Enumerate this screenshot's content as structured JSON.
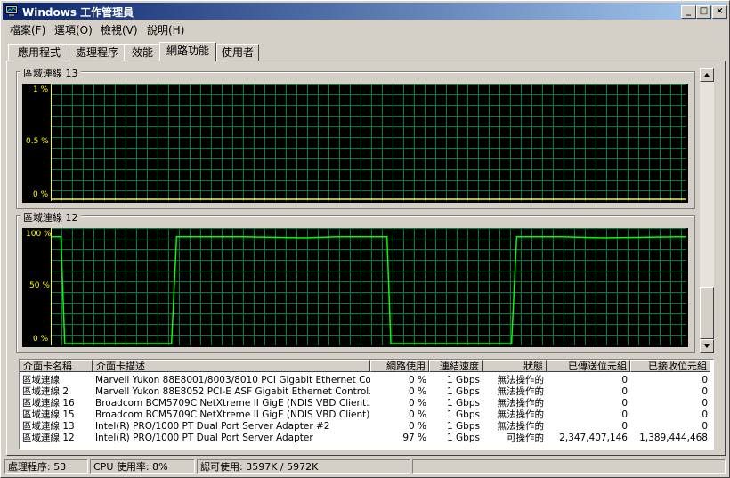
{
  "window": {
    "title": "Windows 工作管理員"
  },
  "title_buttons": {
    "minimize": "_",
    "maximize": "□",
    "close": "×"
  },
  "menu": [
    {
      "label": "檔案(F)"
    },
    {
      "label": "選項(O)"
    },
    {
      "label": "檢視(V)"
    },
    {
      "label": "說明(H)"
    }
  ],
  "tabs": [
    {
      "label": "應用程式"
    },
    {
      "label": "處理程序"
    },
    {
      "label": "效能"
    },
    {
      "label": "網路功能"
    },
    {
      "label": "使用者"
    }
  ],
  "graphs": [
    {
      "title": "區域連線 13",
      "y_labels": [
        "1 %",
        "0.5 %",
        "0 %"
      ],
      "ylim": [
        0,
        1
      ],
      "unit": "%",
      "series": [
        [
          0,
          0
        ],
        [
          1,
          0
        ]
      ],
      "color": "#ffff00"
    },
    {
      "title": "區域連線 12",
      "y_labels": [
        "100 %",
        "50 %",
        "0 %"
      ],
      "ylim": [
        0,
        100
      ],
      "unit": "%",
      "series": [
        [
          0,
          97
        ],
        [
          0.016,
          97
        ],
        [
          0.022,
          0
        ],
        [
          0.19,
          0
        ],
        [
          0.198,
          97
        ],
        [
          0.3,
          97
        ],
        [
          0.4,
          96
        ],
        [
          0.45,
          97
        ],
        [
          0.529,
          97
        ],
        [
          0.535,
          0
        ],
        [
          0.725,
          0
        ],
        [
          0.733,
          97
        ],
        [
          0.8,
          97
        ],
        [
          0.87,
          96
        ],
        [
          1,
          97
        ]
      ],
      "color": "#00ff00"
    }
  ],
  "adapter_table": {
    "columns": [
      "介面卡名稱",
      "介面卡描述",
      "網路使用",
      "連結速度",
      "狀態",
      "已傳送位元組",
      "已接收位元組"
    ],
    "rows": [
      [
        "區域連線",
        "Marvell Yukon 88E8001/8003/8010 PCI Gigabit Ethernet Co...",
        "0 %",
        "1 Gbps",
        "無法操作的",
        "0",
        "0"
      ],
      [
        "區域連線 2",
        "Marvell Yukon 88E8052 PCI-E ASF Gigabit Ethernet Control...",
        "0 %",
        "1 Gbps",
        "無法操作的",
        "0",
        "0"
      ],
      [
        "區域連線 16",
        "Broadcom BCM5709C NetXtreme II GigE (NDIS VBD Client...",
        "0 %",
        "1 Gbps",
        "無法操作的",
        "0",
        "0"
      ],
      [
        "區域連線 15",
        "Broadcom BCM5709C NetXtreme II GigE (NDIS VBD Client)",
        "0 %",
        "1 Gbps",
        "無法操作的",
        "0",
        "0"
      ],
      [
        "區域連線 13",
        "Intel(R) PRO/1000 PT Dual Port Server Adapter #2",
        "0 %",
        "1 Gbps",
        "無法操作的",
        "0",
        "0"
      ],
      [
        "區域連線 12",
        "Intel(R) PRO/1000 PT Dual Port Server Adapter",
        "97 %",
        "1 Gbps",
        "可操作的",
        "2,347,407,146",
        "1,389,444,468"
      ]
    ]
  },
  "status": {
    "processes": "處理程序: 53",
    "cpu": "CPU 使用率: 8%",
    "commit": "認可使用: 3597K / 5972K"
  },
  "colors": {
    "grid": "#008040",
    "graph_bg": "#000000",
    "title_start": "#0a246a",
    "title_end": "#a6caf0"
  }
}
